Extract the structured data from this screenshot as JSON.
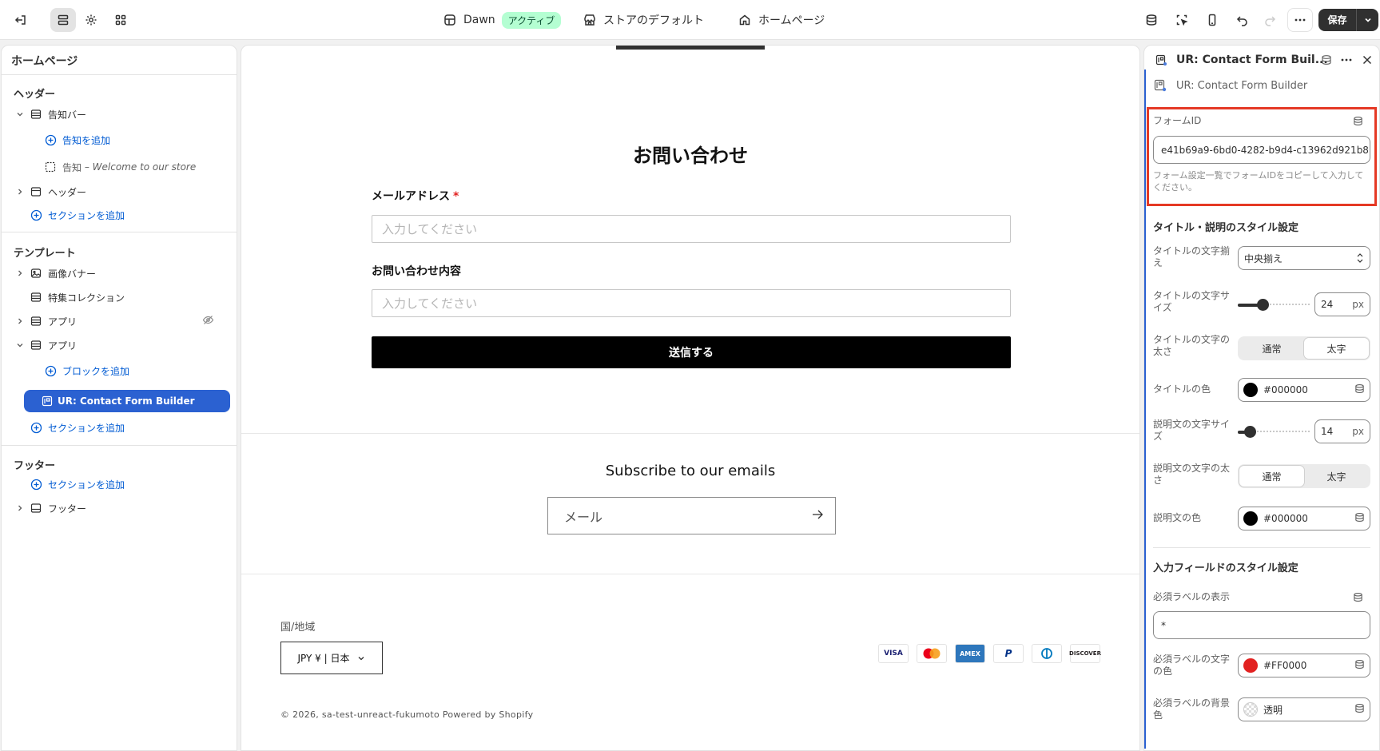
{
  "topbar": {
    "theme_name": "Dawn",
    "theme_status": "アクティブ",
    "store_default": "ストアのデフォルト",
    "page": "ホームページ",
    "save_label": "保存"
  },
  "sidebar": {
    "title": "ホームページ",
    "header_group": "ヘッダー",
    "announcement_bar": "告知バー",
    "add_announcement": "告知を追加",
    "announcement_prefix": "告知",
    "announcement_text": "– Welcome to our store",
    "header": "ヘッダー",
    "add_section_1": "セクションを追加",
    "template_group": "テンプレート",
    "image_banner": "画像バナー",
    "featured_collection": "特集コレクション",
    "app_1": "アプリ",
    "app_2": "アプリ",
    "add_block": "ブロックを追加",
    "selected_block": "UR: Contact Form Builder",
    "add_section_2": "セクションを追加",
    "footer_group": "フッター",
    "add_section_3": "セクションを追加",
    "footer": "フッター"
  },
  "preview": {
    "form_title": "お問い合わせ",
    "email_label": "メールアドレス",
    "required_mark": "*",
    "email_placeholder": "入力してください",
    "message_label": "お問い合わせ内容",
    "message_placeholder": "入力してください",
    "submit_label": "送信する",
    "subscribe_title": "Subscribe to our emails",
    "subscribe_placeholder": "メール",
    "region_label": "国/地域",
    "region_value": "JPY ¥ | 日本",
    "payments": [
      "VISA",
      "Mastercard",
      "AMEX",
      "P",
      "Diners",
      "DISCOVER"
    ],
    "copyright": "© 2026, sa-test-unreact-fukumoto Powered by Shopify"
  },
  "panel": {
    "title": "UR: Contact Form Buil...",
    "subtitle": "UR: Contact Form Builder",
    "form_id_label": "フォームID",
    "form_id_value": "e41b69a9-6bd0-4282-b9d4-c13962d921b8",
    "form_id_help": "フォーム設定一覧でフォームIDをコピーして入力してください。",
    "title_style_section": "タイトル・説明のスタイル設定",
    "title_align_label": "タイトルの文字揃え",
    "title_align_value": "中央揃え",
    "title_size_label": "タイトルの文字サイズ",
    "title_size_value": "24",
    "title_size_fraction": 0.3,
    "unit_px": "px",
    "title_weight_label": "タイトルの文字の太さ",
    "weight_normal": "通常",
    "weight_bold": "太字",
    "title_weight_selected": "bold",
    "title_color_label": "タイトルの色",
    "title_color_value": "#000000",
    "desc_size_label": "説明文の文字サイズ",
    "desc_size_value": "14",
    "desc_size_fraction": 0.12,
    "desc_weight_label": "説明文の文字の太さ",
    "desc_weight_selected": "normal",
    "desc_color_label": "説明文の色",
    "desc_color_value": "#000000",
    "input_style_section": "入力フィールドのスタイル設定",
    "required_display_label": "必須ラベルの表示",
    "required_display_value": "*",
    "required_color_label": "必須ラベルの文字の色",
    "required_color_value": "#FF0000",
    "required_bg_label": "必須ラベルの背景色",
    "required_bg_value": "透明"
  },
  "colors": {
    "accent_blue": "#2b61d1",
    "link_blue": "#005bd3",
    "highlight_red": "#e53925",
    "required_red": "#e22120"
  }
}
